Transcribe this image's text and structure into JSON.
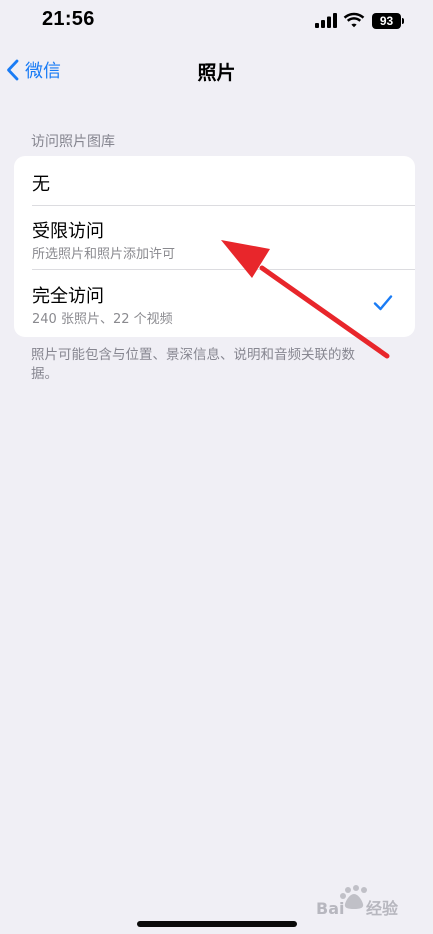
{
  "status_bar": {
    "time": "21:56",
    "battery_level": "93",
    "icons": [
      "signal-icon",
      "wifi-icon",
      "battery-icon"
    ]
  },
  "nav": {
    "back_label": "微信",
    "back_icon": "chevron-left-icon",
    "title": "照片"
  },
  "section": {
    "header": "访问照片图库",
    "options": [
      {
        "title": "无",
        "subtitle": "",
        "selected": false
      },
      {
        "title": "受限访问",
        "subtitle": "所选照片和照片添加许可",
        "selected": false
      },
      {
        "title": "完全访问",
        "subtitle": "240 张照片、22 个视频",
        "selected": true
      }
    ],
    "footer": "照片可能包含与位置、景深信息、说明和音频关联的数据。"
  },
  "watermark": "Bai 经验",
  "colors": {
    "accent": "#1a7cf5",
    "background": "#f0eff5",
    "annotation_arrow": "#e8262b"
  }
}
